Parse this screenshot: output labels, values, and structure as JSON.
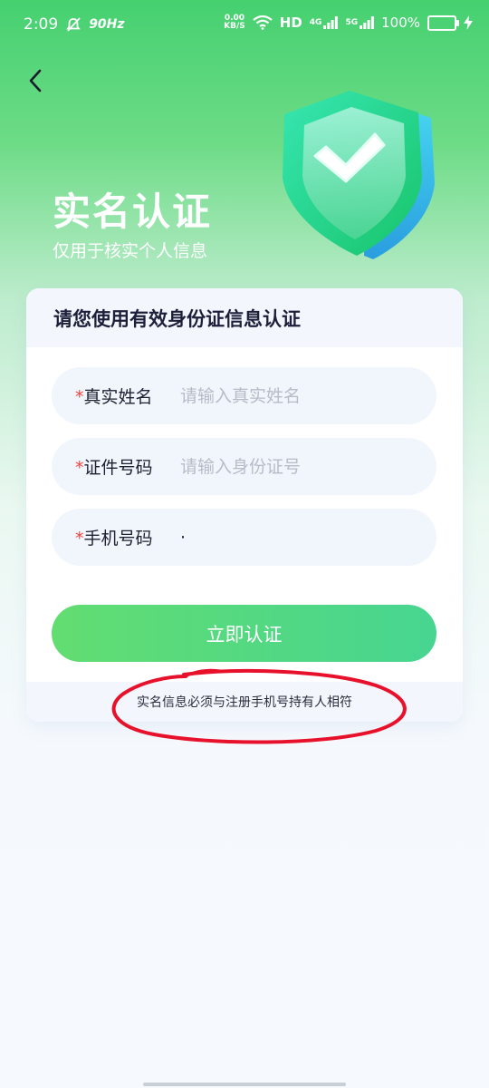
{
  "status_bar": {
    "time": "2:09",
    "refresh": "90Hz",
    "speed_value": "0.00",
    "speed_unit": "KB/S",
    "hd1": "HD",
    "net_4g": "4G",
    "net_5g": "5G",
    "battery": "100%",
    "icons": [
      "alarm-off-icon",
      "wifi-icon",
      "signal-icon",
      "battery-icon",
      "charging-icon"
    ]
  },
  "header": {
    "title": "实名认证",
    "subtitle": "仅用于核实个人信息",
    "back_icon": "chevron-left-icon",
    "badge_icon": "shield-check-icon"
  },
  "card": {
    "heading": "请您使用有效身份证信息认证",
    "fields": [
      {
        "required_mark": "*",
        "label": "真实姓名",
        "placeholder": "请输入真实姓名",
        "value": ""
      },
      {
        "required_mark": "*",
        "label": "证件号码",
        "placeholder": "请输入身份证号",
        "value": ""
      },
      {
        "required_mark": "*",
        "label": "手机号码",
        "placeholder": "",
        "value": "·"
      }
    ],
    "submit_label": "立即认证",
    "footer_note": "实名信息必须与注册手机号持有人相符"
  },
  "colors": {
    "brand_green": "#45d070",
    "button_start": "#62dd71",
    "button_end": "#47d591",
    "required_red": "#f2453d",
    "annotation_red": "#e8112b"
  }
}
